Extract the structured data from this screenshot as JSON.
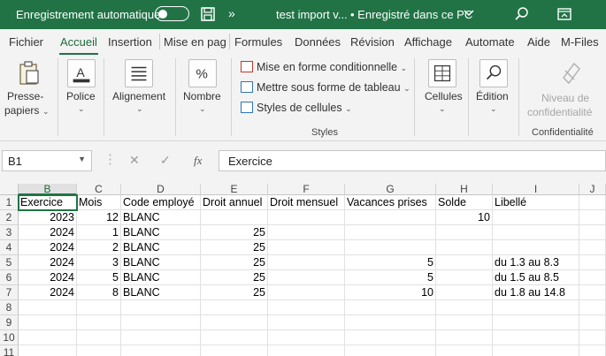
{
  "titlebar": {
    "autosave_label": "Enregistrement automatique",
    "more": "»",
    "doc_title": "test import v...",
    "saved_status": "• Enregistré dans ce PC"
  },
  "menu": {
    "tabs": [
      "Fichier",
      "Accueil",
      "Insertion",
      "Mise en pag",
      "Formules",
      "Données",
      "Révision",
      "Affichage",
      "Automate",
      "Aide",
      "M-Files"
    ],
    "active": "Accueil"
  },
  "ribbon": {
    "paste": [
      "Presse-",
      "papiers"
    ],
    "font": "Police",
    "alignment": "Alignement",
    "number": "Nombre",
    "styles": {
      "conditional": "Mise en forme conditionnelle",
      "table": "Mettre sous forme de tableau",
      "cell_styles": "Styles de cellules",
      "group_label": "Styles"
    },
    "cells": "Cellules",
    "editing": "Édition",
    "sensitivity": [
      "Niveau de",
      "confidentialité"
    ],
    "sensitivity_group": "Confidentialité"
  },
  "formula_bar": {
    "name_box": "B1",
    "fx": "fx",
    "value": "Exercice"
  },
  "sheet": {
    "columns": [
      "B",
      "C",
      "D",
      "E",
      "F",
      "G",
      "H",
      "I",
      "J"
    ],
    "selected_column": "B",
    "row_numbers": [
      "1",
      "2",
      "3",
      "4",
      "5",
      "6",
      "7",
      "8",
      "9",
      "10",
      "11"
    ],
    "header_row": [
      "Exercice",
      "Mois",
      "Code employé",
      "Droit annuel",
      "Droit mensuel",
      "Vacances prises",
      "Solde",
      "Libellé"
    ],
    "rows": [
      [
        "2023",
        "12",
        "BLANC",
        "",
        "",
        "",
        "10",
        ""
      ],
      [
        "2024",
        "1",
        "BLANC",
        "25",
        "",
        "",
        "",
        ""
      ],
      [
        "2024",
        "2",
        "BLANC",
        "25",
        "",
        "",
        "",
        ""
      ],
      [
        "2024",
        "3",
        "BLANC",
        "25",
        "",
        "5",
        "",
        "du 1.3 au 8.3"
      ],
      [
        "2024",
        "5",
        "BLANC",
        "25",
        "",
        "5",
        "",
        "du 1.5 au 8.5"
      ],
      [
        "2024",
        "8",
        "BLANC",
        "25",
        "",
        "10",
        "",
        "du 1.8 au 14.8"
      ]
    ],
    "selected_cell": "B1"
  },
  "colors": {
    "brand": "#217346",
    "ribbon_bg": "#f3f3f3"
  }
}
